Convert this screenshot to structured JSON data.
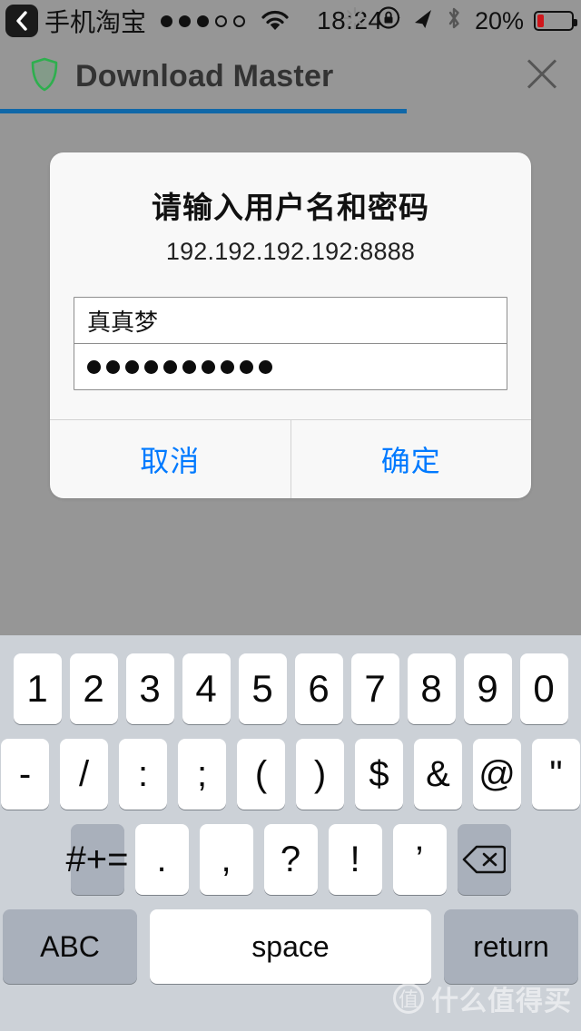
{
  "status_bar": {
    "back_icon": "back-chevron-icon",
    "carrier_app": "手机淘宝",
    "signal": {
      "icon": "signal-dots-icon",
      "filled": 3,
      "total": 5
    },
    "wifi_icon": "wifi-icon",
    "time": "18:24",
    "right_icons": [
      {
        "name": "activity-spinner-icon"
      },
      {
        "name": "rotation-lock-icon"
      },
      {
        "name": "location-arrow-icon"
      },
      {
        "name": "bluetooth-icon"
      }
    ],
    "battery_percent": "20%",
    "battery_level": 20,
    "battery_color": "#d0161b"
  },
  "title_bar": {
    "shield_icon": "shield-icon",
    "shield_color": "#2eaf4e",
    "title": "Download Master",
    "close_icon": "close-icon",
    "progress_percent": 70,
    "progress_color": "#1068a8"
  },
  "dialog": {
    "title": "请输入用户名和密码",
    "subtitle": "192.192.192.192:8888",
    "username": {
      "value": "真真梦",
      "placeholder": ""
    },
    "password": {
      "masked_char_count": 10,
      "placeholder": ""
    },
    "cancel_label": "取消",
    "confirm_label": "确定",
    "button_color": "#007aff"
  },
  "keyboard": {
    "row1": [
      "1",
      "2",
      "3",
      "4",
      "5",
      "6",
      "7",
      "8",
      "9",
      "0"
    ],
    "row2": [
      "-",
      "/",
      ":",
      ";",
      "(",
      ")",
      "$",
      "&",
      "@",
      "\""
    ],
    "row3_symbols_label": "#+=",
    "row3": [
      ".",
      ",",
      "?",
      "!",
      "’"
    ],
    "backspace_icon": "backspace-icon",
    "abc_label": "ABC",
    "space_label": "space",
    "return_label": "return"
  },
  "watermark": {
    "logo_char": "值",
    "text": "什么值得买"
  }
}
